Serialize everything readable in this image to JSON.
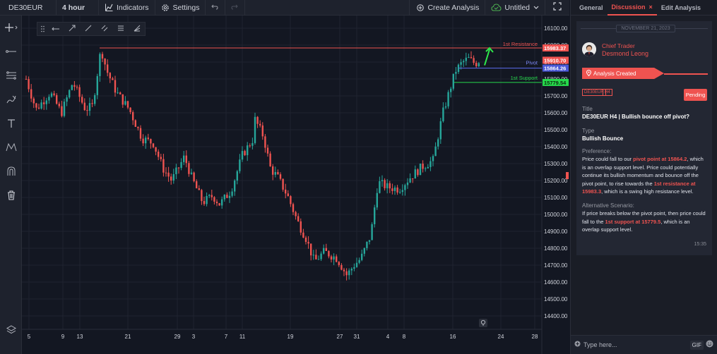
{
  "toolbar": {
    "symbol": "DE30EUR",
    "interval": "4 hour",
    "indicators": "Indicators",
    "settings": "Settings",
    "create_analysis": "Create Analysis",
    "layout_name": "Untitled"
  },
  "chart": {
    "price_axis": [
      "16100.00",
      "16000.00",
      "15900.00",
      "15800.00",
      "15700.00",
      "15600.00",
      "15500.00",
      "15400.00",
      "15300.00",
      "15200.00",
      "15100.00",
      "15000.00",
      "14900.00",
      "14800.00",
      "14700.00",
      "14600.00",
      "14500.00",
      "14400.00"
    ],
    "time_axis": [
      "5",
      "9",
      "13",
      "21",
      "29",
      "3",
      "7",
      "11",
      "19",
      "27",
      "31",
      "4",
      "8",
      "16",
      "24",
      "28"
    ],
    "lines": {
      "resistance_label": "1st Resistance",
      "resistance_price": "15983.37",
      "pivot_label": "Pivot",
      "pivot_price": "15864.26",
      "support_label": "1st Support",
      "support_price": "15779.54",
      "current_price": "15910.70"
    },
    "colors": {
      "up": "#26a69a",
      "down": "#ef5350",
      "resistance": "#ef5350",
      "pivot": "#5b6cf0",
      "support": "#26d94b"
    }
  },
  "panel": {
    "tabs": [
      "General",
      "Discussion",
      "Edit Analysis"
    ],
    "date": "NOVEMBER 21, 2023",
    "role": "Chief Trader",
    "author": "Desmond Leong",
    "status_banner": "Analysis Created",
    "tag_symbol": "DE30EUR",
    "tag_tf": "H4",
    "status": "Pending",
    "title_label": "Title",
    "title_value": "DE30EUR H4 | Bullish bounce off pivot?",
    "type_label": "Type",
    "type_value": "Bullish Bounce",
    "pref_label": "Preference:",
    "pref_1": "Price could fall to our ",
    "pref_h1": "pivot point at 15864.2",
    "pref_2": ", which is an overlap support level. Price could potentially continue its bullish momentum and bounce off the pivot point, to rise towards the ",
    "pref_h2": "1st resistance at 15983.3",
    "pref_3": ", which is a swing high resistance level.",
    "alt_label": "Alternative Scenario:",
    "alt_1": "If price breaks below the pivot point, then price could fall to the ",
    "alt_h1": "1st support at 15779.5",
    "alt_2": ", which is an overlap support level.",
    "time": "15:35",
    "chat_placeholder": "Type here...",
    "gif": "GIF"
  }
}
